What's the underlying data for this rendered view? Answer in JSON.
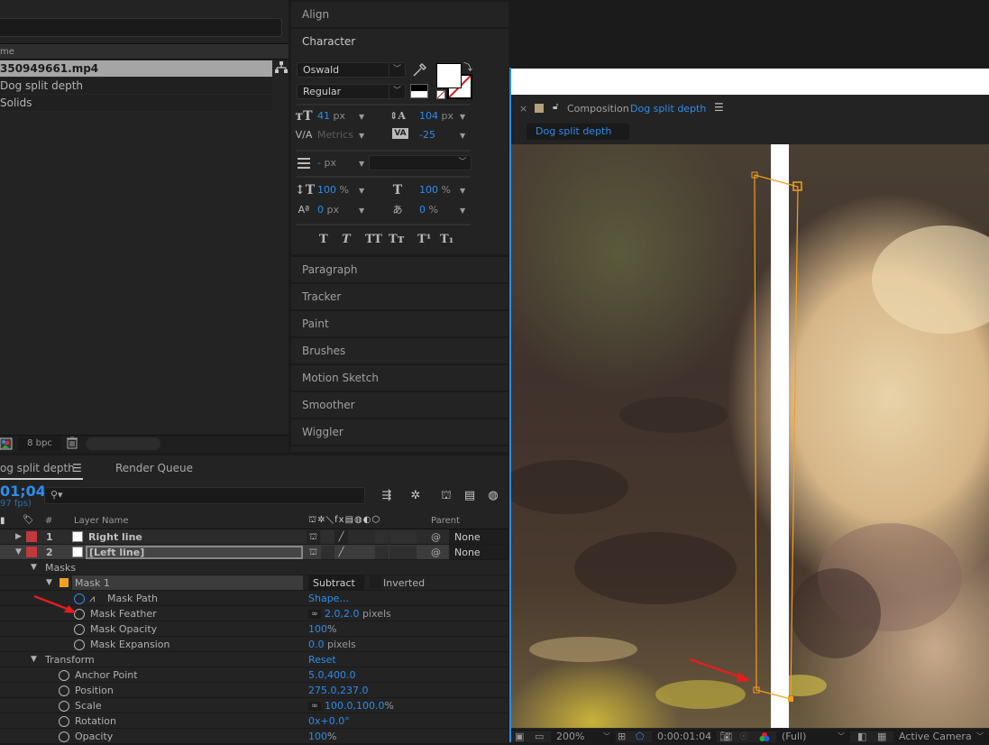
{
  "project": {
    "column_header": "me",
    "items": [
      {
        "name": "350949661.mp4",
        "selected": true
      },
      {
        "name": "Dog split depth",
        "selected": false
      },
      {
        "name": "Solids",
        "selected": false
      }
    ],
    "footer": {
      "bpc": "8 bpc"
    }
  },
  "panels": {
    "align": "Align",
    "character": {
      "title": "Character",
      "font_family": "Oswald",
      "font_style": "Regular",
      "font_size": "41",
      "font_size_unit": "px",
      "leading": "104",
      "leading_unit": "px",
      "kerning": "Metrics",
      "tracking": "-25",
      "stroke_width": "-",
      "stroke_unit": "px",
      "stroke_type": "",
      "vertical_scale": "100",
      "vertical_scale_unit": "%",
      "horizontal_scale": "100",
      "horizontal_scale_unit": "%",
      "baseline_shift": "0",
      "baseline_unit": "px",
      "tsume": "0",
      "tsume_unit": "%",
      "fill_color": "#ffffff",
      "styles": [
        "T",
        "T",
        "TT",
        "Tт",
        "T¹",
        "T₁"
      ]
    },
    "collapsed": [
      "Paragraph",
      "Tracker",
      "Paint",
      "Brushes",
      "Motion Sketch",
      "Smoother",
      "Wiggler"
    ]
  },
  "composition": {
    "tab_label": "Composition",
    "comp_name": "Dog split depth",
    "breadcrumb": "Dog split depth",
    "zoom": "200%",
    "timecode": "0:00:01:04",
    "resolution": "(Full)",
    "camera": "Active Camera"
  },
  "timeline": {
    "tab_comp": "og split depth",
    "tab_render": "Render Queue",
    "current_time": "01;04",
    "fps": "97 fps)",
    "columns": {
      "num": "#",
      "layer_name": "Layer Name",
      "parent": "Parent"
    },
    "layers": [
      {
        "num": "1",
        "name": "Right line",
        "parent": "None",
        "expanded": false,
        "label_color": "#c0393b"
      },
      {
        "num": "2",
        "name": "[Left line]",
        "parent": "None",
        "expanded": true,
        "label_color": "#c0393b"
      }
    ],
    "masks_label": "Masks",
    "mask": {
      "name": "Mask 1",
      "mode": "Subtract",
      "inverted_label": "Inverted",
      "color": "#f0a020",
      "properties": [
        {
          "name": "Mask Path",
          "value": "Shape...",
          "unit": "",
          "linked": false,
          "animated": true
        },
        {
          "name": "Mask Feather",
          "value": "2.0,2.0",
          "unit": "pixels",
          "linked": true,
          "animated": false
        },
        {
          "name": "Mask Opacity",
          "value": "100",
          "unit": "%",
          "linked": false,
          "animated": false
        },
        {
          "name": "Mask Expansion",
          "value": "0.0",
          "unit": "pixels",
          "linked": false,
          "animated": false
        }
      ]
    },
    "transform": {
      "label": "Transform",
      "reset": "Reset",
      "properties": [
        {
          "name": "Anchor Point",
          "value": "5.0,400.0",
          "unit": "",
          "linked": false
        },
        {
          "name": "Position",
          "value": "275.0,237.0",
          "unit": "",
          "linked": false
        },
        {
          "name": "Scale",
          "value": "100.0,100.0",
          "unit": "%",
          "linked": true
        },
        {
          "name": "Rotation",
          "value": "0x+0.0°",
          "unit": "",
          "linked": false
        },
        {
          "name": "Opacity",
          "value": "100",
          "unit": "%",
          "linked": false
        }
      ]
    }
  },
  "colors": {
    "accent_blue": "#2d8ceb",
    "mask_orange": "#f0a020",
    "annotation_red": "#e02020"
  }
}
